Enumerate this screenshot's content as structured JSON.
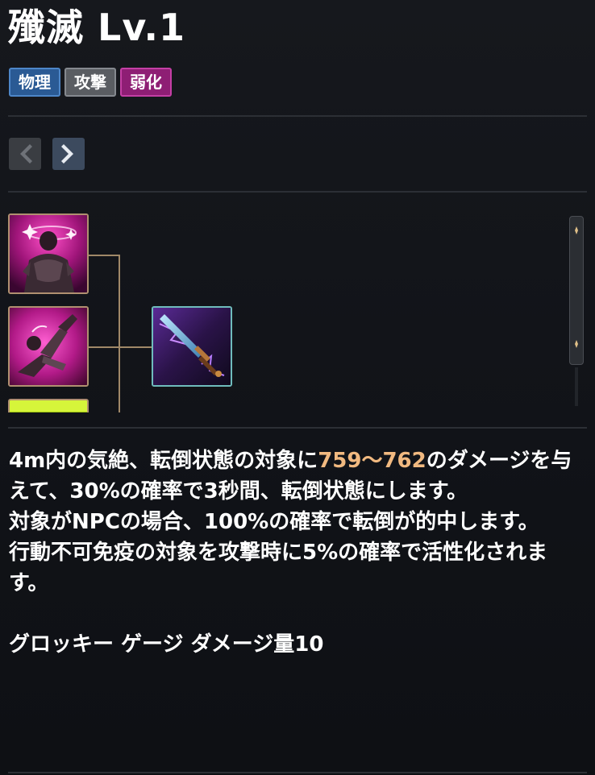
{
  "skill": {
    "title": "殲滅 Lv.1",
    "tags": [
      {
        "label": "物理",
        "color": "#2a5a94"
      },
      {
        "label": "攻撃",
        "color": "#5a5d62"
      },
      {
        "label": "弱化",
        "color": "#8e1e74"
      }
    ]
  },
  "navigation": {
    "prev_icon": "chevron-left-icon",
    "next_icon": "chevron-right-icon"
  },
  "tree": {
    "nodes": [
      {
        "icon": "stunned-knight-skill-icon"
      },
      {
        "icon": "knockdown-skill-icon"
      },
      {
        "icon": "yellow-skill-icon"
      },
      {
        "icon": "lightning-sword-skill-icon"
      }
    ]
  },
  "description": {
    "line1_before": "4m内の気絶、転倒状態の対象に",
    "damage_range": "759〜762",
    "line1_after": "のダメージを与えて、30%の確率で3秒間、転倒状態にします。",
    "line2": "対象がNPCの場合、100%の確率で転倒が的中します。",
    "line3": "行動不可免疫の対象を攻撃時に5%の確率で活性化されます。",
    "groggy": "グロッキー ゲージ ダメージ量10",
    "highlight_color": "#f1b980"
  }
}
